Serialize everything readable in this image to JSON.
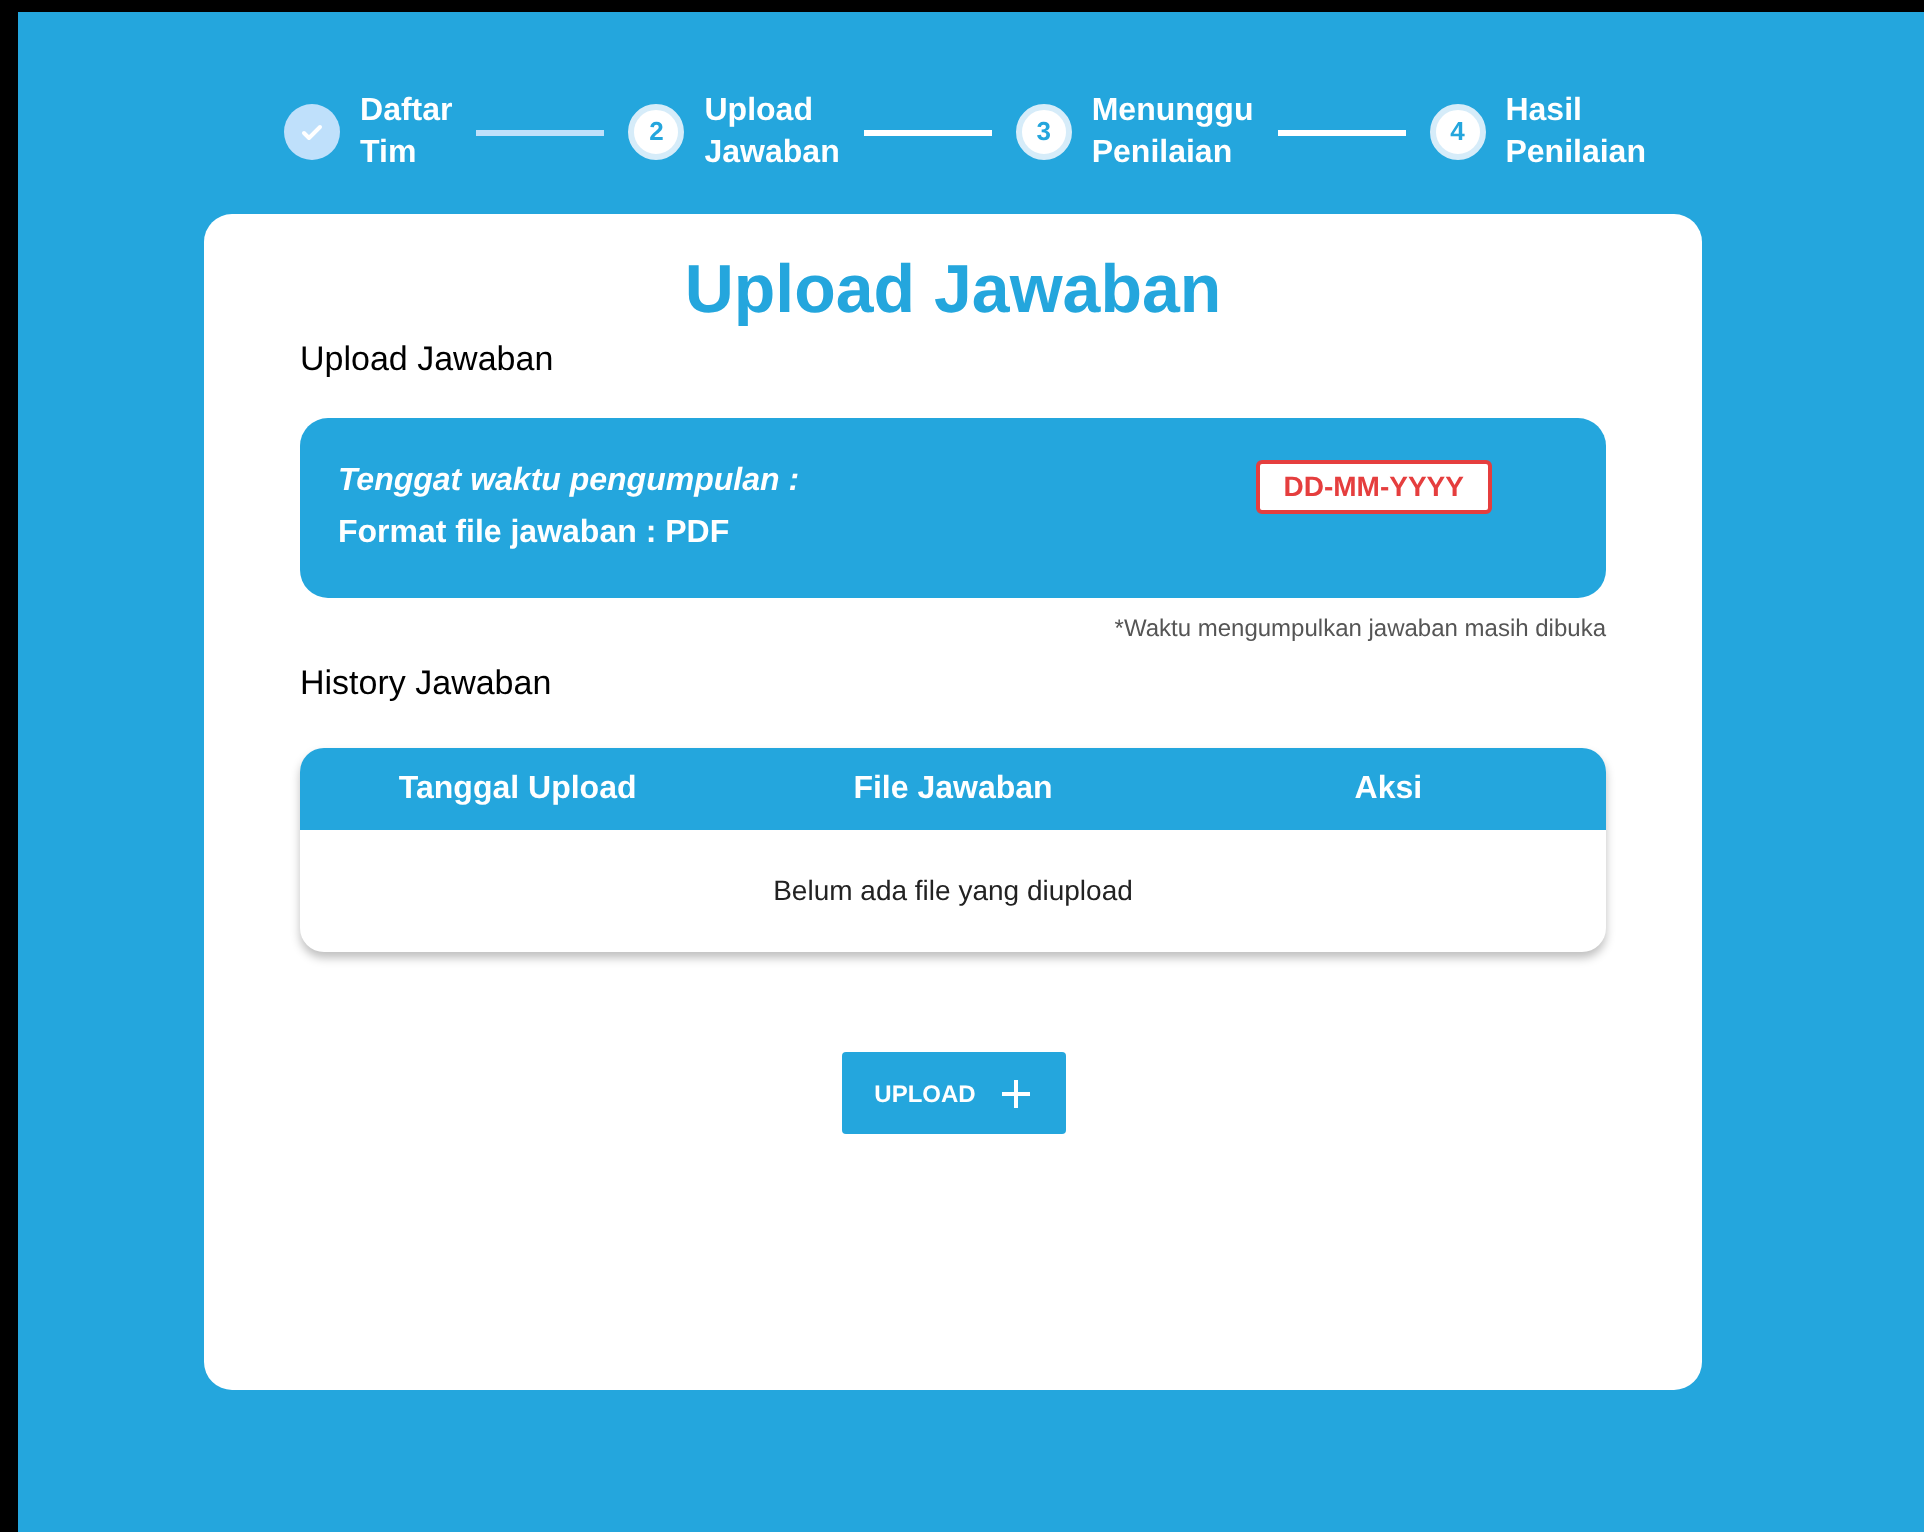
{
  "steps": [
    {
      "label_lines": [
        "Daftar",
        "Tim"
      ],
      "done": true
    },
    {
      "number": "2",
      "label_lines": [
        "Upload",
        "Jawaban"
      ],
      "done": false
    },
    {
      "number": "3",
      "label_lines": [
        "Menunggu",
        "Penilaian"
      ],
      "done": false
    },
    {
      "number": "4",
      "label_lines": [
        "Hasil",
        "Penilaian"
      ],
      "done": false
    }
  ],
  "card": {
    "title": "Upload Jawaban",
    "section_upload": "Upload Jawaban",
    "info": {
      "deadline_label": "Tenggat waktu pengumpulan :",
      "deadline_value": "DD-MM-YYYY",
      "format": "Format file jawaban : PDF"
    },
    "note": "*Waktu mengumpulkan jawaban masih dibuka",
    "section_history": "History Jawaban",
    "table": {
      "columns": [
        "Tanggal Upload",
        "File Jawaban",
        "Aksi"
      ],
      "empty_message": "Belum ada file yang diupload"
    },
    "upload_button": "UPLOAD"
  }
}
